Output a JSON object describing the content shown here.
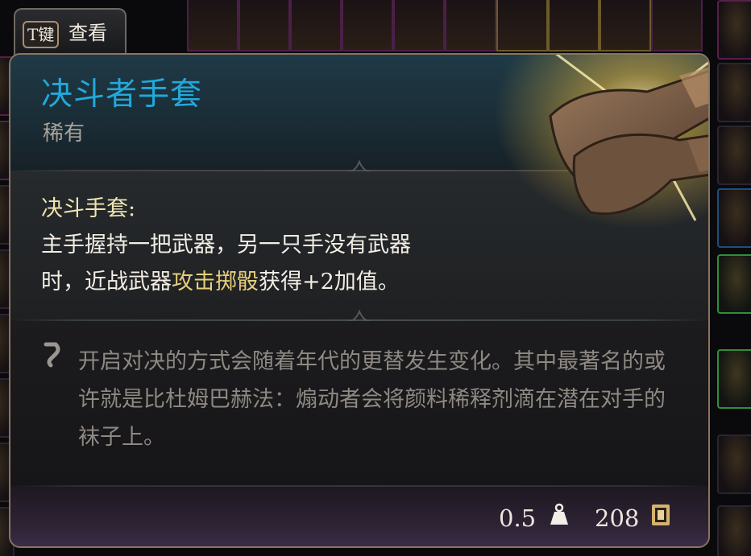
{
  "inspect_tab": {
    "key": "T键",
    "label": "查看"
  },
  "item": {
    "name": "决斗者手套",
    "rarity": "稀有",
    "name_color": "#21a9dc",
    "art_icon": "leather-gloves-icon"
  },
  "ability": {
    "title": "决斗手套:",
    "desc_line1": "主手握持一把武器，另一只手没有武器",
    "desc_line2_pre": "时，近战武器",
    "desc_line2_highlight": "攻击掷骰",
    "desc_line2_post": "获得+2加值。"
  },
  "lore": {
    "icon": "quill-icon",
    "text": "开启对决的方式会随着年代的更替发生变化。其中最著名的或许就是比杜姆巴赫法：煽动者会将颜料稀释剂滴在潜在对手的袜子上。"
  },
  "footer": {
    "weight": "0.5",
    "weight_icon": "weight-icon",
    "price": "208",
    "price_icon": "coin-icon"
  }
}
